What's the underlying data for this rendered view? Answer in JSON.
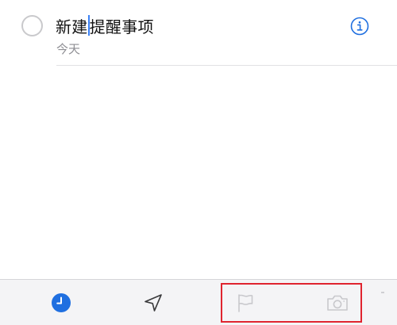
{
  "reminder": {
    "title_before_caret": "新建",
    "title_after_caret": "提醒事项",
    "date": "今天"
  },
  "toolbar": {
    "items": [
      {
        "name": "clock-icon",
        "state": "active"
      },
      {
        "name": "location-arrow-icon",
        "state": "enabled"
      },
      {
        "name": "flag-icon",
        "state": "disabled"
      },
      {
        "name": "camera-icon",
        "state": "disabled"
      }
    ]
  },
  "annotation": {
    "highlight": "red-box-around-flag-and-camera"
  },
  "colors": {
    "accent": "#1f6fe0",
    "title_text": "#111111",
    "secondary_text": "#8e8e93",
    "icon_dark": "#3a3a3c",
    "icon_disabled": "#c8c8cc",
    "toolbar_bg": "#f4f4f6",
    "highlight_red": "#e0242f",
    "caret": "#3b82f6"
  }
}
